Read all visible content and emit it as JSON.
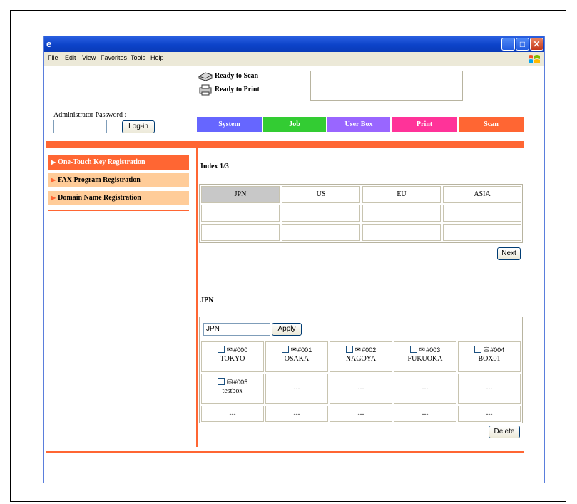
{
  "window": {
    "menu": [
      "File",
      "Edit",
      "View",
      "Favorites",
      "Tools",
      "Help"
    ],
    "controls": [
      "minimize",
      "maximize",
      "close"
    ]
  },
  "status": {
    "scan": "Ready to Scan",
    "print": "Ready to Print"
  },
  "admin": {
    "label": "Administrator Password :",
    "login_label": "Log-in"
  },
  "tabs": [
    {
      "label": "System",
      "color": "#6666ff"
    },
    {
      "label": "Job",
      "color": "#33cc33"
    },
    {
      "label": "User Box",
      "color": "#9966ff"
    },
    {
      "label": "Print",
      "color": "#ff3399"
    },
    {
      "label": "Scan",
      "color": "#ff6633"
    }
  ],
  "sidebar": {
    "items": [
      {
        "label": "One-Touch Key Registration",
        "active": true
      },
      {
        "label": "FAX Program Registration",
        "active": false
      },
      {
        "label": "Domain Name Registration",
        "active": false
      }
    ]
  },
  "index": {
    "title": "Index 1/3",
    "headers": [
      "JPN",
      "US",
      "EU",
      "ASIA"
    ],
    "selected": "JPN",
    "next_label": "Next"
  },
  "destinations": {
    "title": "JPN",
    "filter_value": "JPN",
    "apply_label": "Apply",
    "rows": [
      [
        {
          "icon": "mail-icon",
          "num": "#000",
          "name": "TOKYO"
        },
        {
          "icon": "mail-icon",
          "num": "#001",
          "name": "OSAKA"
        },
        {
          "icon": "mail-icon",
          "num": "#002",
          "name": "NAGOYA"
        },
        {
          "icon": "mail-icon",
          "num": "#003",
          "name": "FUKUOKA"
        },
        {
          "icon": "box-icon",
          "num": "#004",
          "name": "BOX01"
        }
      ],
      [
        {
          "icon": "box-icon",
          "num": "#005",
          "name": "testbox"
        },
        {
          "empty": "---"
        },
        {
          "empty": "---"
        },
        {
          "empty": "---"
        },
        {
          "empty": "---"
        }
      ],
      [
        {
          "empty": "---"
        },
        {
          "empty": "---"
        },
        {
          "empty": "---"
        },
        {
          "empty": "---"
        },
        {
          "empty": "---"
        }
      ]
    ],
    "delete_label": "Delete"
  }
}
